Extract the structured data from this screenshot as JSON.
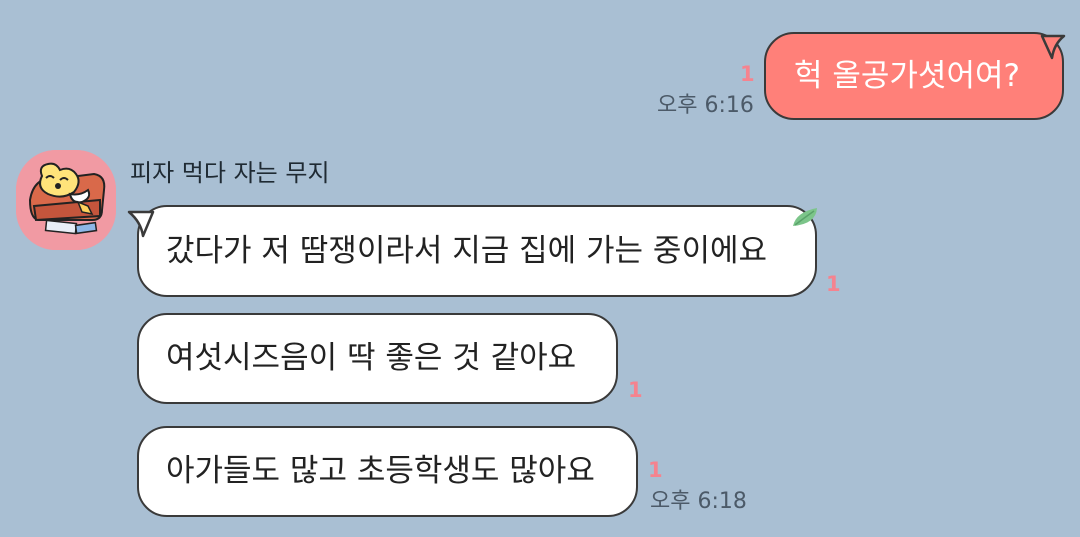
{
  "messages": {
    "outgoing": {
      "text": "헉 올공가셧어여?",
      "unread": "1",
      "time": "오후 6:16"
    },
    "incoming": {
      "sender_name": "피자 먹다 자는 무지",
      "avatar_icon": "muzi-sleeping-on-pizza-sofa-icon",
      "items": [
        {
          "text": "갔다가 저 땀쟁이라서 지금 집에 가는 중이에요",
          "unread": "1"
        },
        {
          "text": "여섯시즈음이 딱 좋은 것 같아요",
          "unread": "1"
        },
        {
          "text": "아가들도 많고 초등학생도 많아요",
          "unread": "1"
        }
      ],
      "time": "오후 6:18"
    }
  },
  "colors": {
    "background": "#a9bfd3",
    "outgoing_bubble": "#ff8079",
    "incoming_bubble": "#ffffff",
    "unread": "#f5838f",
    "bubble_border": "#3a3a3a"
  }
}
